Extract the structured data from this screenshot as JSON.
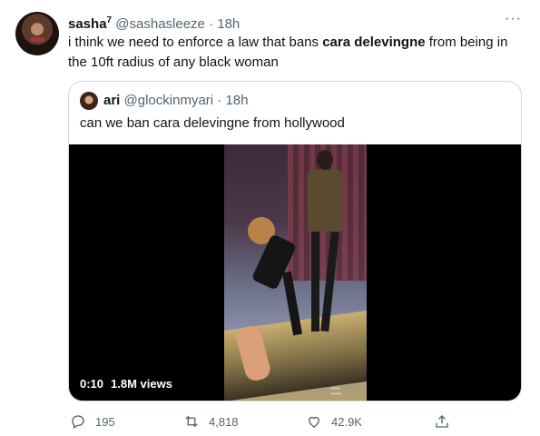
{
  "author": {
    "name": "sasha",
    "badge": "7",
    "handle": "@sashasleeze",
    "separator": "·",
    "time": "18h"
  },
  "tweet": {
    "text_before": "i think we need to enforce a law that bans ",
    "text_bold": "cara delevingne",
    "text_after": " from being in the 10ft radius of any black woman"
  },
  "more_label": "···",
  "quoted": {
    "name": "ari",
    "handle": "@glockinmyari",
    "separator": "·",
    "time": "18h",
    "text": "can we ban cara delevingne from hollywood",
    "video": {
      "time": "0:10",
      "views": "1.8M views",
      "progress": 0
    }
  },
  "actions": {
    "replies": "195",
    "retweets": "4,818",
    "likes": "42.9K"
  },
  "colors": {
    "text": "#0f1419",
    "muted": "#536471",
    "border": "#cfd9de"
  }
}
